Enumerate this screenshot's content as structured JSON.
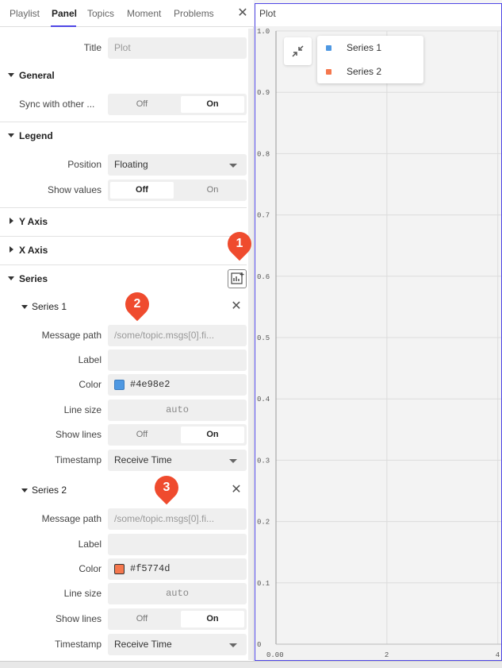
{
  "tabs": [
    "Playlist",
    "Panel",
    "Topics",
    "Moment",
    "Problems"
  ],
  "active_tab": "Panel",
  "title_row": {
    "label": "Title",
    "placeholder": "Plot"
  },
  "sections": {
    "general": "General",
    "legend": "Legend",
    "y_axis": "Y Axis",
    "x_axis": "X Axis",
    "series": "Series"
  },
  "general": {
    "sync_label": "Sync with other ...",
    "sync_options": [
      "Off",
      "On"
    ],
    "sync_selected": "On"
  },
  "legend": {
    "position_label": "Position",
    "position_value": "Floating",
    "show_values_label": "Show values",
    "show_values_options": [
      "Off",
      "On"
    ],
    "show_values_selected": "Off"
  },
  "series_list": [
    {
      "name": "Series 1",
      "message_path_label": "Message path",
      "message_path_placeholder": "/some/topic.msgs[0].fi...",
      "label_label": "Label",
      "label_value": "",
      "color_label": "Color",
      "color_value": "#4e98e2",
      "line_size_label": "Line size",
      "line_size_value": "auto",
      "show_lines_label": "Show lines",
      "show_lines_options": [
        "Off",
        "On"
      ],
      "show_lines_selected": "On",
      "timestamp_label": "Timestamp",
      "timestamp_value": "Receive Time"
    },
    {
      "name": "Series 2",
      "message_path_label": "Message path",
      "message_path_placeholder": "/some/topic.msgs[0].fi...",
      "label_label": "Label",
      "label_value": "",
      "color_label": "Color",
      "color_value": "#f5774d",
      "line_size_label": "Line size",
      "line_size_value": "auto",
      "show_lines_label": "Show lines",
      "show_lines_options": [
        "Off",
        "On"
      ],
      "show_lines_selected": "On",
      "timestamp_label": "Timestamp",
      "timestamp_value": "Receive Time"
    }
  ],
  "callouts": [
    "1",
    "2",
    "3"
  ],
  "plot": {
    "title": "Plot",
    "legend": [
      {
        "name": "Series 1",
        "color": "#4e98e2"
      },
      {
        "name": "Series 2",
        "color": "#f5774d"
      }
    ]
  },
  "chart_data": {
    "type": "line",
    "title": "Plot",
    "xlabel": "",
    "ylabel": "",
    "xlim": [
      0,
      4
    ],
    "ylim": [
      0,
      1
    ],
    "x_ticks": [
      "0.00",
      "2",
      "4"
    ],
    "y_ticks": [
      "0",
      "0.1",
      "0.2",
      "0.3",
      "0.4",
      "0.5",
      "0.6",
      "0.7",
      "0.8",
      "0.9",
      "1.0"
    ],
    "grid": true,
    "legend_placement": "top-left",
    "series": [
      {
        "name": "Series 1",
        "color": "#4e98e2",
        "values": []
      },
      {
        "name": "Series 2",
        "color": "#f5774d",
        "values": []
      }
    ]
  }
}
